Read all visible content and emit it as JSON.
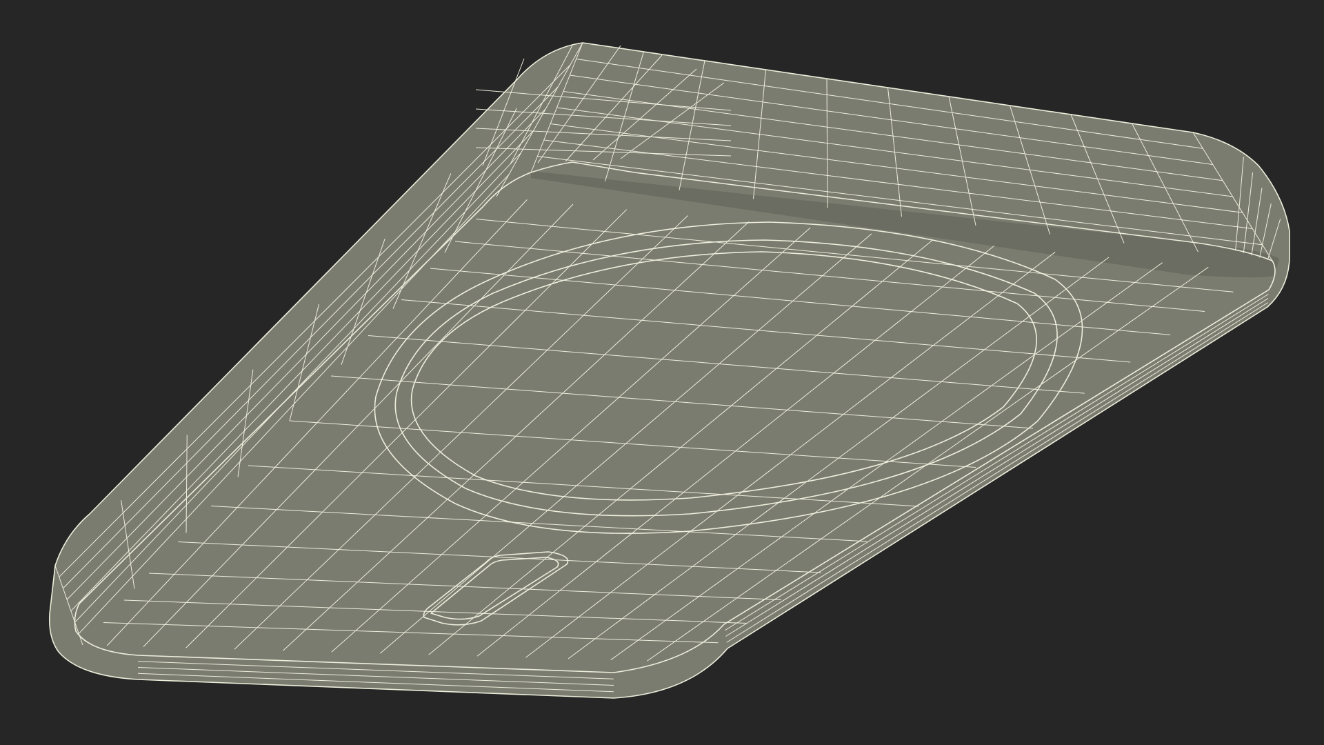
{
  "scene": {
    "subject": "wireframe-render",
    "style": "wireframe-on-shaded"
  },
  "colors": {
    "background": "#262626",
    "surface": "#7b7c70",
    "surface_dark": "#707166",
    "wire": "#eeeedc",
    "crease": "#5f6057"
  }
}
